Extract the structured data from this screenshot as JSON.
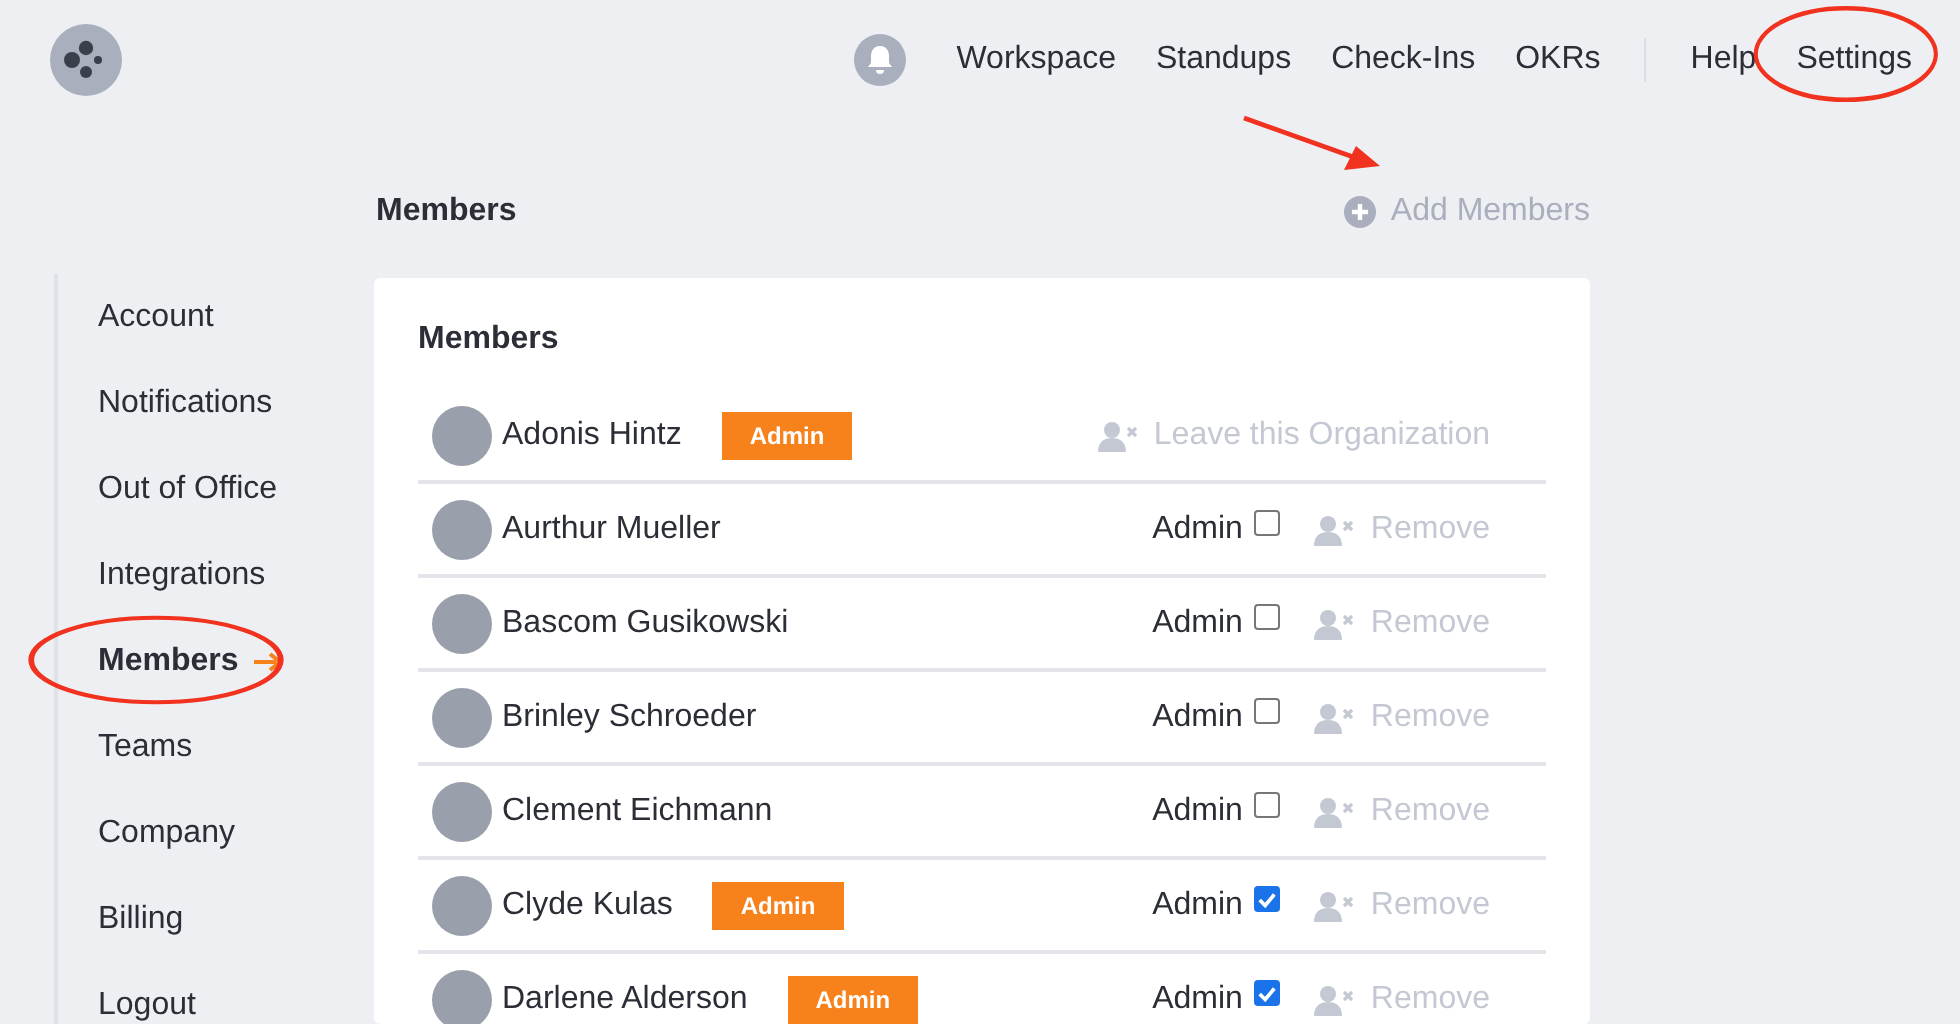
{
  "nav": {
    "primary": [
      {
        "label": "Workspace",
        "circled": false
      },
      {
        "label": "Standups",
        "circled": false
      },
      {
        "label": "Check-Ins",
        "circled": false
      },
      {
        "label": "OKRs",
        "circled": false
      }
    ],
    "secondary": [
      {
        "label": "Help",
        "circled": false
      },
      {
        "label": "Settings",
        "circled": true
      }
    ]
  },
  "page": {
    "title": "Members",
    "add_button": {
      "label": "Add Members",
      "pointed": true
    }
  },
  "sidebar": {
    "items": [
      {
        "label": "Account",
        "selected": false,
        "circled": false
      },
      {
        "label": "Notifications",
        "selected": false,
        "circled": false
      },
      {
        "label": "Out of Office",
        "selected": false,
        "circled": false
      },
      {
        "label": "Integrations",
        "selected": false,
        "circled": false
      },
      {
        "label": "Members",
        "selected": true,
        "circled": true
      },
      {
        "label": "Teams",
        "selected": false,
        "circled": false
      },
      {
        "label": "Company",
        "selected": false,
        "circled": false
      },
      {
        "label": "Billing",
        "selected": false,
        "circled": false
      },
      {
        "label": "Logout",
        "selected": false,
        "circled": false
      }
    ]
  },
  "card": {
    "title": "Members",
    "members": [
      {
        "kind": "self",
        "name": "Adonis Hintz",
        "badge": "Admin",
        "action": "Leave this Organization"
      },
      {
        "kind": "member",
        "name": "Aurthur Mueller",
        "admin_label": "Admin",
        "checked": false,
        "action": "Remove"
      },
      {
        "kind": "member",
        "name": "Bascom Gusikowski",
        "admin_label": "Admin",
        "checked": false,
        "action": "Remove"
      },
      {
        "kind": "member",
        "name": "Brinley Schroeder",
        "admin_label": "Admin",
        "checked": false,
        "action": "Remove"
      },
      {
        "kind": "member",
        "name": "Clement Eichmann",
        "admin_label": "Admin",
        "checked": false,
        "action": "Remove"
      },
      {
        "kind": "member",
        "name": "Clyde Kulas",
        "badge": "Admin",
        "admin_label": "Admin",
        "checked": true,
        "action": "Remove"
      },
      {
        "kind": "member",
        "name": "Darlene Alderson",
        "badge": "Admin",
        "admin_label": "Admin",
        "checked": true,
        "action": "Remove"
      }
    ]
  }
}
